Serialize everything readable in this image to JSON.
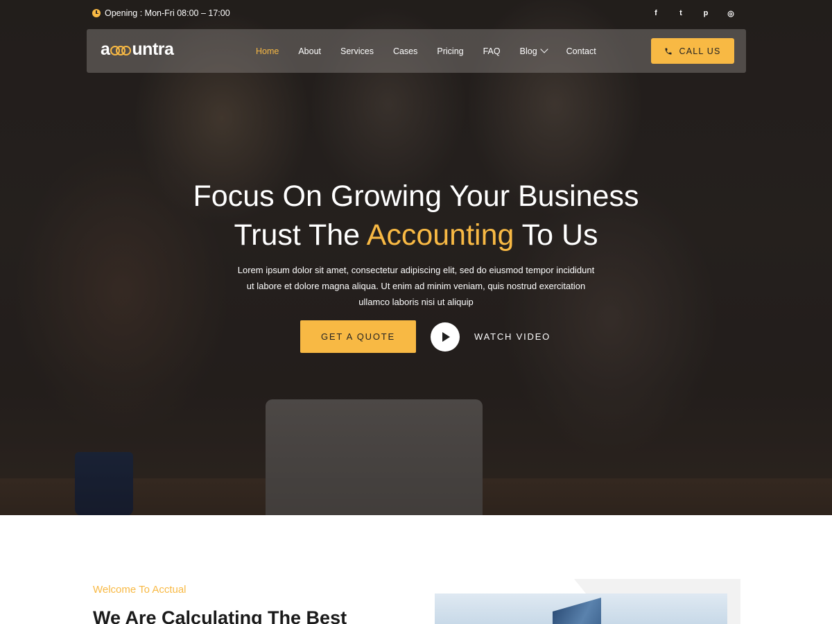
{
  "topbar": {
    "hours_text": "Opening : Mon-Fri 08:00 – 17:00",
    "socials": [
      {
        "icon": "facebook-icon",
        "glyph": "f"
      },
      {
        "icon": "twitter-icon",
        "glyph": "t"
      },
      {
        "icon": "pinterest-icon",
        "glyph": "p"
      },
      {
        "icon": "instagram-icon",
        "glyph": "◎"
      }
    ]
  },
  "navbar": {
    "logo_prefix": "a",
    "logo_suffix": "untra",
    "items": [
      {
        "label": "Home",
        "active": true
      },
      {
        "label": "About"
      },
      {
        "label": "Services"
      },
      {
        "label": "Cases"
      },
      {
        "label": "Pricing"
      },
      {
        "label": "FAQ"
      },
      {
        "label": "Blog",
        "has_dropdown": true
      },
      {
        "label": "Contact"
      }
    ],
    "call_label": "CALL US"
  },
  "hero": {
    "title_line1": "Focus On Growing Your Business",
    "title_line2_pre": "Trust The ",
    "title_line2_accent": "Accounting",
    "title_line2_post": " To Us",
    "description": "Lorem ipsum dolor sit amet, consectetur adipiscing elit, sed do eiusmod tempor incididunt ut labore et dolore magna aliqua. Ut enim ad minim veniam, quis nostrud exercitation ullamco laboris nisi ut aliquip",
    "quote_label": "GET A QUOTE",
    "watch_label": "WATCH VIDEO"
  },
  "welcome": {
    "kicker": "Welcome To Acctual",
    "heading": "We Are Calculating The Best"
  },
  "colors": {
    "accent": "#f8b944",
    "dark": "#222222"
  }
}
